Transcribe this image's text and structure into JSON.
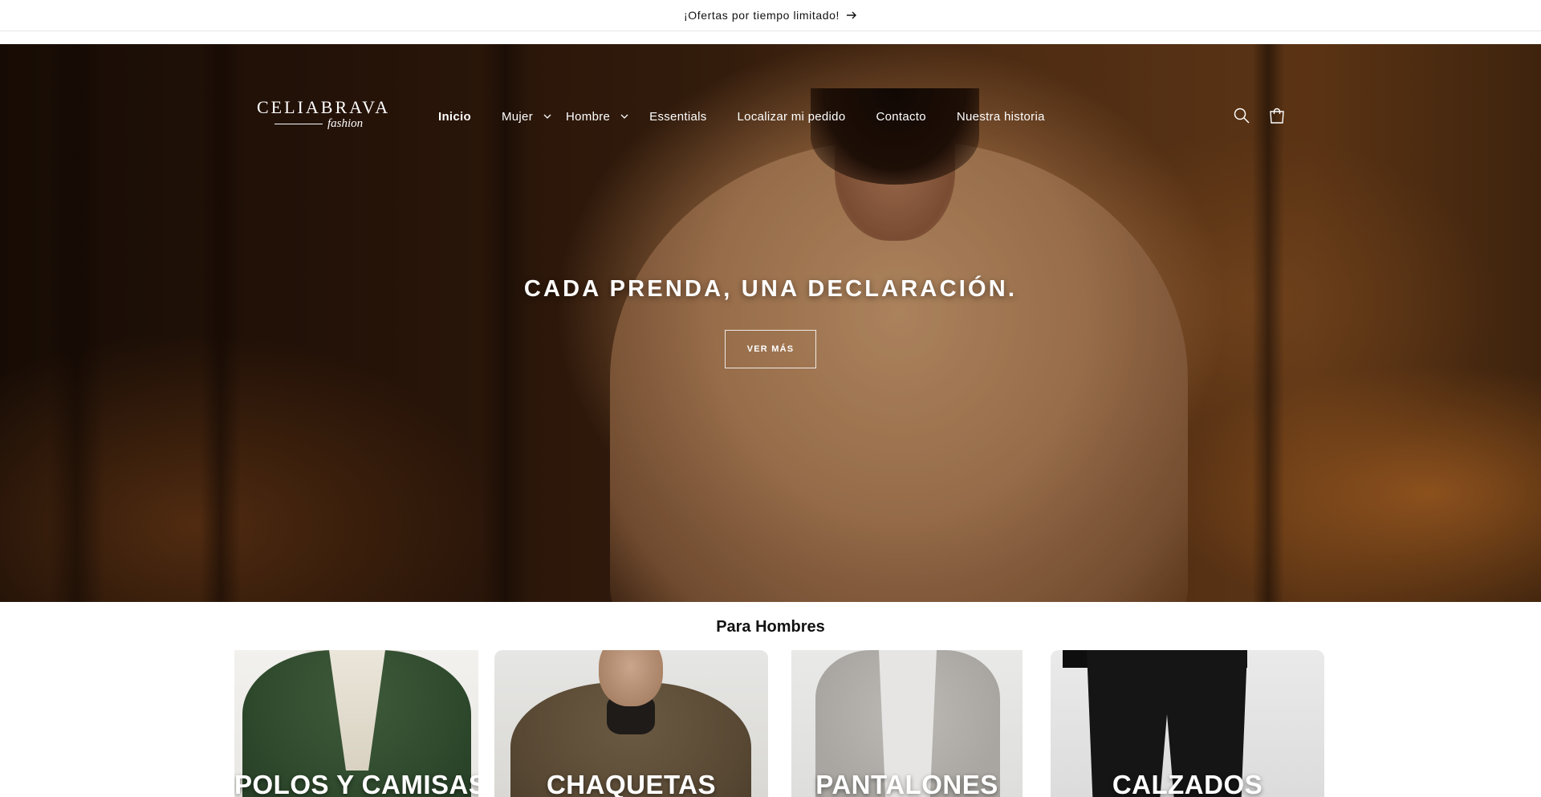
{
  "announcement": {
    "text": "¡Ofertas por tiempo limitado!"
  },
  "header": {
    "logo": {
      "brand": "CELIABRAVA",
      "sub": "fashion"
    },
    "nav": {
      "inicio": "Inicio",
      "mujer": "Mujer",
      "hombre": "Hombre",
      "essentials": "Essentials",
      "localizar": "Localizar mi pedido",
      "contacto": "Contacto",
      "historia": "Nuestra historia"
    }
  },
  "hero": {
    "title": "CADA PRENDA, UNA DECLARACIÓN.",
    "button": "VER MÁS"
  },
  "section": {
    "title": "Para Hombres",
    "cards": {
      "polos": "POLOS Y CAMISAS",
      "chaquetas": "CHAQUETAS",
      "pantalones": "PANTALONES",
      "calzados": "CALZADOS"
    }
  },
  "icons": {
    "announcement_arrow": "arrow-right-icon",
    "search": "search-icon",
    "cart": "cart-icon",
    "dropdown": "chevron-down-icon"
  },
  "colors": {
    "text": "#121212",
    "overlay_text": "#ffffff",
    "border": "#e5e5e5"
  }
}
